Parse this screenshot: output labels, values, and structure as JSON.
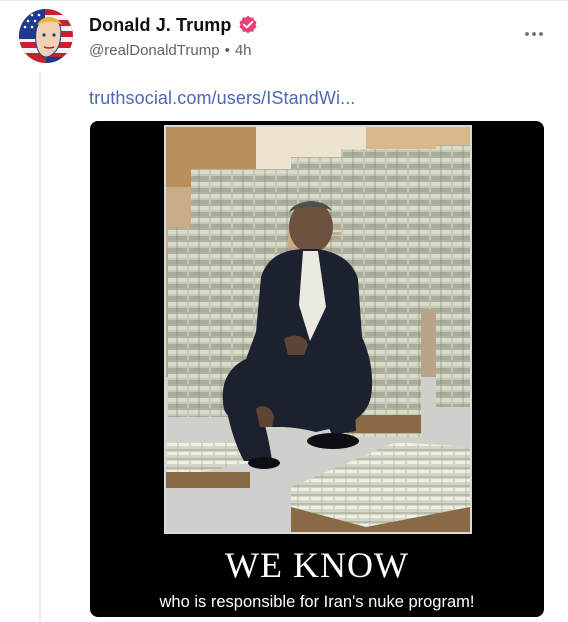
{
  "post": {
    "author": {
      "display_name": "Donald J. Trump",
      "handle": "@realDonaldTrump",
      "separator": "•",
      "time_ago": "4h",
      "verified": true,
      "verified_badge_icon": "verified-badge-icon",
      "avatar_icon": "avatar-flag-portrait"
    },
    "more_menu_icon": "ellipsis-icon",
    "link_text": "truthsocial.com/users/IStandWi...",
    "media": {
      "headline": "WE KNOW",
      "caption": "who is responsible for Iran's nuke program!",
      "photo_subject": "photo"
    }
  },
  "colors": {
    "link": "#4b67b5",
    "verified_badge": "#e8417a",
    "name": "#101010",
    "meta": "#5f6268",
    "poster_background": "#000000"
  }
}
